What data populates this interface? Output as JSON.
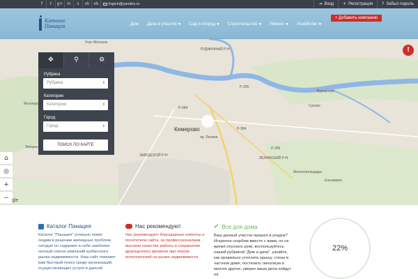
{
  "topbar": {
    "social_icons": [
      "facebook-icon",
      "twitter-icon",
      "google-plus-icon",
      "linkedin-icon",
      "skype-icon",
      "vk-icon",
      "odnoklassniki-icon"
    ],
    "social_glyphs": [
      "f",
      "t",
      "g+",
      "in",
      "s",
      "vk",
      "ok"
    ],
    "email": "fogich@yandex.ru",
    "login": "Вход",
    "register": "Регистрация",
    "forgot": "Забыл пароль"
  },
  "header": {
    "logo_line1": "Каталог",
    "logo_line2": "Панацея",
    "menu": [
      {
        "label": "Дом",
        "dropdown": false
      },
      {
        "label": "Дача и участок",
        "dropdown": true
      },
      {
        "label": "Сад и огород",
        "dropdown": true
      },
      {
        "label": "Строительство",
        "dropdown": true
      },
      {
        "label": "Ремонт",
        "dropdown": true
      },
      {
        "label": "Хозяйство",
        "dropdown": true
      }
    ],
    "add_company": "+ Добавить компанию"
  },
  "map": {
    "city": "Кемерово",
    "labels": [
      "Улус-Мохнуха",
      "РУДНИЧНЫЙ Р-Н",
      "ЗАВОДСКОЙ Р-Н",
      "ЛЕНИНСКИЙ Р-Н",
      "Сухово",
      "Журавлево",
      "Металлплощадка",
      "Ельникино",
      "Ясногорский",
      "Звездный",
      "пр. Ленина",
      "Р-255",
      "Р-384",
      "Р-384",
      "Р-255"
    ],
    "search_panel": {
      "tabs": [
        "move-icon",
        "search-icon",
        "settings-icon"
      ],
      "rubric_label": "Рубрика",
      "rubric_value": "Рубрика",
      "category_label": "Категория",
      "category_value": "Категория",
      "city_label": "Город",
      "city_value": "Город",
      "search_button": "ПОИСК ПО КАРТЕ"
    },
    "controls": [
      "home-icon",
      "locate-icon",
      "zoom-in-icon",
      "zoom-out-icon"
    ],
    "alert_glyph": "!",
    "google": "gle"
  },
  "columns": [
    {
      "icon": "catalog-icon",
      "color": "#2d6fb2",
      "title": "Каталог Панацея",
      "text": "Каталог \"Панацея\" успешно помог людям в решении жилищных проблем, сегодня он содержит в себе наиболее полный список компаний кузбасского рынка недвижимости. Наш сайт поможет вам быстрый поиск среди организаций, осуществляющих услуги в данной"
    },
    {
      "icon": "chat-icon",
      "color": "#c9302c",
      "title": "Нас рекомендуют",
      "text": "Нас рекомендуют благодарные клиенты и посетители сайта, за профессионализм , высокое качество работы и сохранение драгоценного времени при поиске исполнителей на рынке недвижимости."
    },
    {
      "icon": "check-icon",
      "color": "#5cb85c",
      "title": "Все для дома",
      "text": "Ваш дачный участок пришел в упадок? Искренне скорбим вместе с вами, но не время опускать руки, воспользуйтесь нашей рубрикой \"Дом и дача\", узнайте, как правильно утеплить крышу, стены в частном доме, постелить линолеум и многое другое, уверен ваши дела пойдут на"
    }
  ],
  "progress": {
    "value": 22,
    "label": "22%"
  },
  "colors": {
    "topbar": "#3a3f4a",
    "nav": "#8ab8d4",
    "accent": "#c9302c",
    "river": "#8fb7e6",
    "logo": "#2d4f86"
  }
}
